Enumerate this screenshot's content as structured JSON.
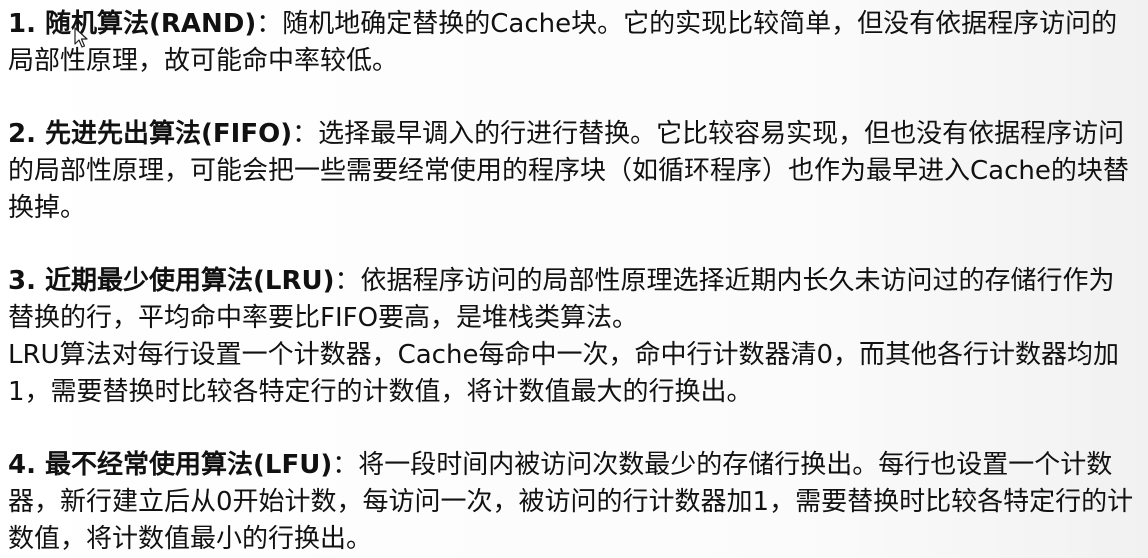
{
  "sections": [
    {
      "paragraphs": [
        {
          "heading": "1. 随机算法(RAND)",
          "text": "：随机地确定替换的Cache块。它的实现比较简单，但没有依据程序访问的局部性原理，故可能命中率较低。"
        }
      ]
    },
    {
      "paragraphs": [
        {
          "heading": "2. 先进先出算法(FIFO)",
          "text": "：选择最早调入的行进行替换。它比较容易实现，但也没有依据程序访问的局部性原理，可能会把一些需要经常使用的程序块（如循环程序）也作为最早进入Cache的块替换掉。"
        }
      ]
    },
    {
      "paragraphs": [
        {
          "heading": "3. 近期最少使用算法(LRU)",
          "text": "：依据程序访问的局部性原理选择近期内长久未访问过的存储行作为替换的行，平均命中率要比FIFO要高，是堆栈类算法。"
        },
        {
          "heading": "",
          "text": "LRU算法对每行设置一个计数器，Cache每命中一次，命中行计数器清0，而其他各行计数器均加1，需要替换时比较各特定行的计数值，将计数值最大的行换出。"
        }
      ]
    },
    {
      "paragraphs": [
        {
          "heading": "4. 最不经常使用算法(LFU)",
          "text": "：将一段时间内被访问次数最少的存储行换出。每行也设置一个计数器，新行建立后从0开始计数，每访问一次，被访问的行计数器加1，需要替换时比较各特定行的计数值，将计数值最小的行换出。"
        }
      ]
    }
  ],
  "cursor": {
    "icon": "mouse-pointer-icon"
  }
}
